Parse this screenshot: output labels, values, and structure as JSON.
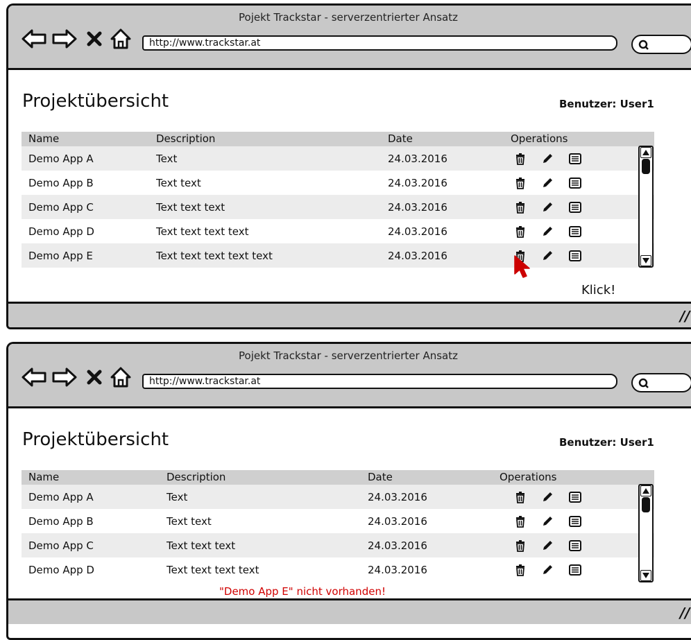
{
  "screens": [
    {
      "browser": {
        "title": "Pojekt Trackstar - serverzentrierter Ansatz",
        "url": "http://www.trackstar.at"
      },
      "page_title": "Projektübersicht",
      "user_label": "Benutzer: User1",
      "columns": [
        "Name",
        "Description",
        "Date",
        "Operations"
      ],
      "rows": [
        {
          "name": "Demo App A",
          "description": "Text",
          "date": "24.03.2016"
        },
        {
          "name": "Demo App B",
          "description": "Text text",
          "date": "24.03.2016"
        },
        {
          "name": "Demo App C",
          "description": "Text text text",
          "date": "24.03.2016"
        },
        {
          "name": "Demo App D",
          "description": "Text text text text",
          "date": "24.03.2016"
        },
        {
          "name": "Demo App E",
          "description": "Text text text text text",
          "date": "24.03.2016"
        }
      ],
      "annotation": "Klick!"
    },
    {
      "browser": {
        "title": "Pojekt Trackstar - serverzentrierter Ansatz",
        "url": "http://www.trackstar.at"
      },
      "page_title": "Projektübersicht",
      "user_label": "Benutzer: User1",
      "columns": [
        "Name",
        "Description",
        "Date",
        "Operations"
      ],
      "rows": [
        {
          "name": "Demo App A",
          "description": "Text",
          "date": "24.03.2016"
        },
        {
          "name": "Demo App B",
          "description": "Text text",
          "date": "24.03.2016"
        },
        {
          "name": "Demo App C",
          "description": "Text text text",
          "date": "24.03.2016"
        },
        {
          "name": "Demo App D",
          "description": "Text text text text",
          "date": "24.03.2016"
        }
      ],
      "error_message": "\"Demo App E\" nicht vorhanden!"
    }
  ],
  "icons": {
    "back": "back-arrow-icon",
    "forward": "forward-arrow-icon",
    "stop": "stop-x-icon",
    "home": "home-icon",
    "search": "search-icon",
    "delete": "trash-icon",
    "edit": "pencil-icon",
    "details": "details-list-icon",
    "cursor": "mouse-pointer-icon",
    "resize": "resize-grip-icon"
  },
  "colors": {
    "chrome": "#c8c8c8",
    "header": "#cfcfcf",
    "row_alt": "#ececec",
    "error": "#d00000",
    "cursor": "#cc0000"
  }
}
